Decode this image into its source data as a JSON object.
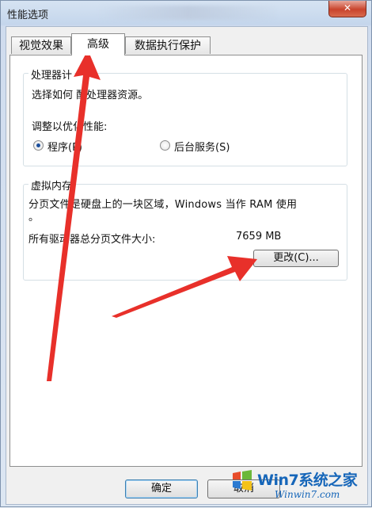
{
  "window": {
    "title": "性能选项",
    "close_glyph": "✕"
  },
  "tabs": [
    {
      "label": "视觉效果"
    },
    {
      "label": "高级"
    },
    {
      "label": "数据执行保护"
    }
  ],
  "processor": {
    "title": "处理器计",
    "description": "选择如何    配处理器资源。",
    "adjust_label": "调整以优化性能:",
    "option_programs": "程序(P)",
    "option_services": "后台服务(S)",
    "selected": "programs"
  },
  "virtual_memory": {
    "title": "虚拟内存",
    "description_line1": "分页文件是硬盘上的一块区域，Windows 当作 RAM 使用",
    "description_line2": "。",
    "total_label": "所有驱动器总分页文件大小:",
    "total_value": "7659 MB",
    "change_button": "更改(C)..."
  },
  "footer": {
    "ok_button": "确定",
    "cancel_button": "取消"
  },
  "watermark": {
    "brand": "Win7系统之家",
    "url": "Winwin7.com"
  },
  "colors": {
    "arrow": "#e8302a",
    "accent": "#1666b9"
  }
}
